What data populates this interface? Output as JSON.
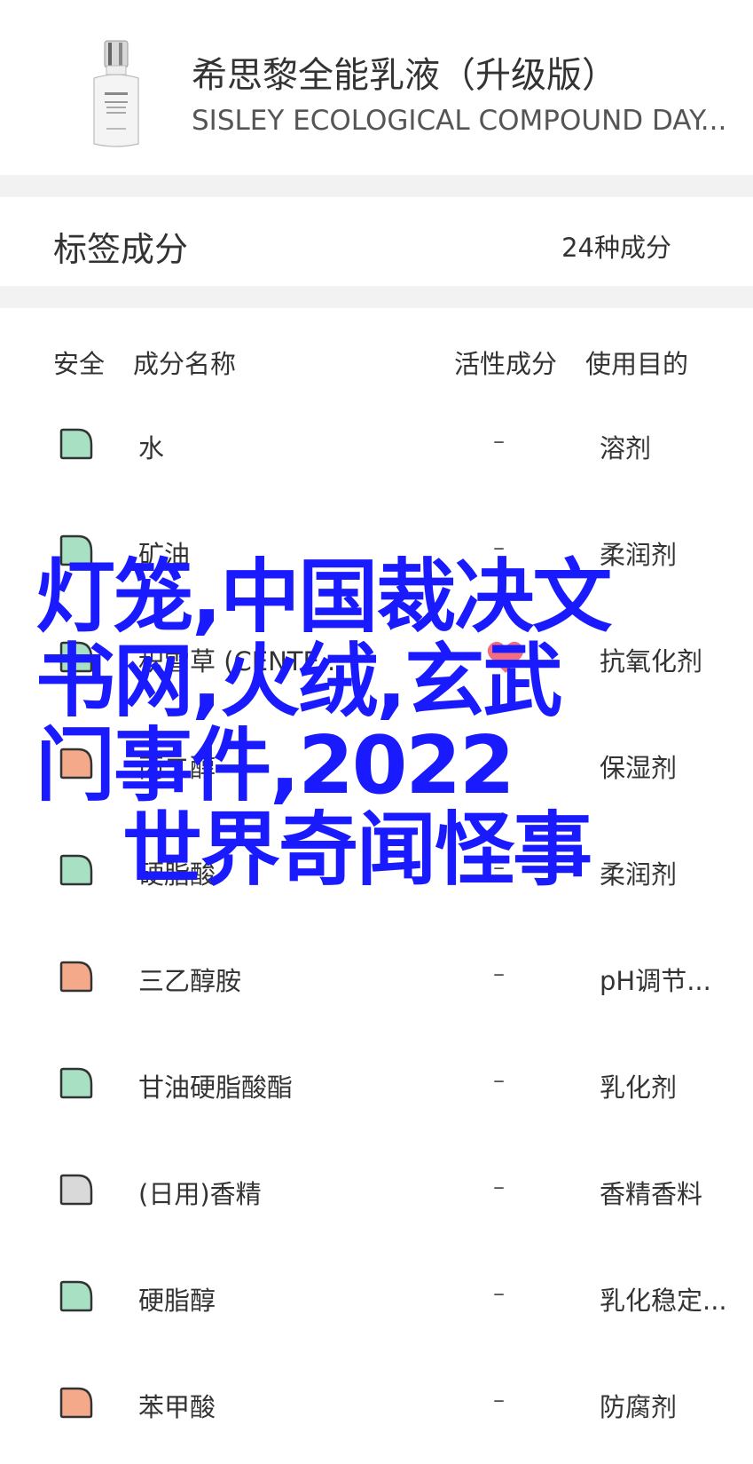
{
  "product": {
    "name_cn": "希思黎全能乳液（升级版）",
    "name_en": "SISLEY ECOLOGICAL COMPOUND DAY..."
  },
  "tags": {
    "title": "标签成分",
    "count": "24种成分"
  },
  "table": {
    "headers": [
      "安全",
      "成分名称",
      "活性成分",
      "使用目的"
    ],
    "rows": [
      {
        "safety": "green",
        "name": "水",
        "active": "–",
        "purpose": "溶剂"
      },
      {
        "safety": "green",
        "name": "矿油",
        "active": "–",
        "purpose": "柔润剂"
      },
      {
        "safety": "green",
        "name": "积雪草 (CENTE...",
        "active": "heart",
        "purpose": "抗氧化剂"
      },
      {
        "safety": "orange",
        "name": "丙二醇",
        "active": "–",
        "purpose": "保湿剂"
      },
      {
        "safety": "green",
        "name": "硬脂酸",
        "active": "–",
        "purpose": "柔润剂"
      },
      {
        "safety": "orange",
        "name": "三乙醇胺",
        "active": "–",
        "purpose": "pH调节..."
      },
      {
        "safety": "green",
        "name": "甘油硬脂酸酯",
        "active": "–",
        "purpose": "乳化剂"
      },
      {
        "safety": "gray",
        "name": "(日用)香精",
        "active": "–",
        "purpose": "香精香料"
      },
      {
        "safety": "green",
        "name": "硬脂醇",
        "active": "–",
        "purpose": "乳化稳定..."
      },
      {
        "safety": "orange",
        "name": "苯甲酸",
        "active": "–",
        "purpose": "防腐剂"
      }
    ]
  },
  "overlay": {
    "line1": "灯笼,中国裁决文",
    "line2": "书网,火绒,玄武",
    "line3": "门事件,2022",
    "line4": "世界奇闻怪事"
  },
  "colors": {
    "green_fill": "#a8e0c4",
    "orange_fill": "#f4a98a",
    "gray_fill": "#d9d9d9",
    "heart": "#f26d7d",
    "overlay_text": "#1a1aff"
  }
}
